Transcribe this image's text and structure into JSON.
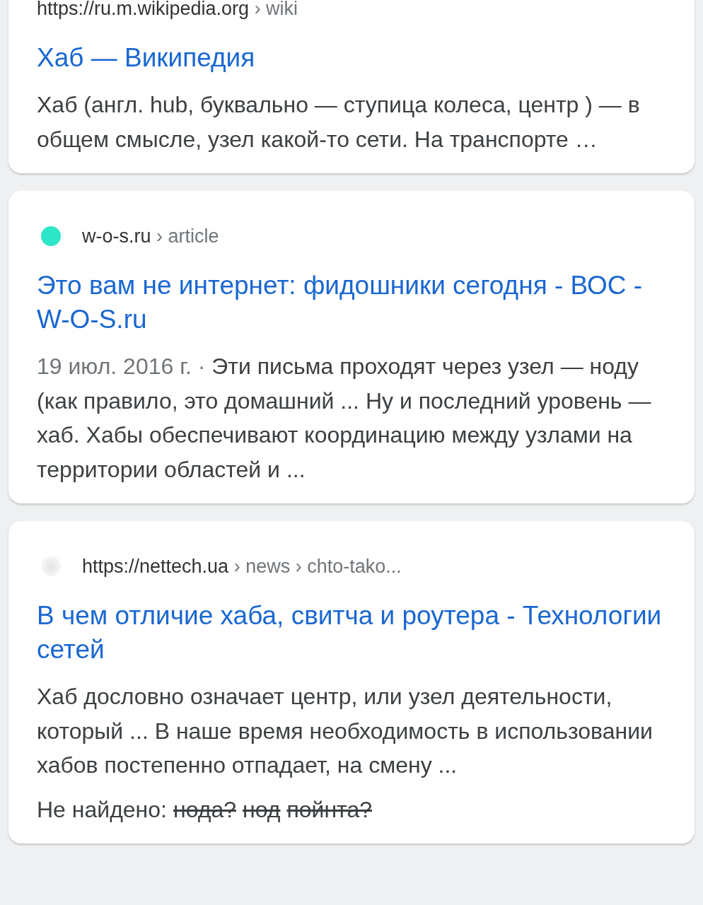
{
  "results": [
    {
      "kind": "plain",
      "site": "https://ru.m.wikipedia.org",
      "path": " › wiki",
      "title": "Хаб — Википедия",
      "snippet": "Хаб (англ. hub, буквально — ступица колеса, центр ) — в общем смысле, узел какой-то сети. На транспорте …"
    },
    {
      "kind": "dot",
      "color": "#2ee6c8",
      "site": "w-o-s.ru",
      "path": " › article",
      "title": "Это вам не интернет: фидошники сегодня - ВОС - W-O-S.ru",
      "date": "19 июл. 2016 г. · ",
      "snippet": "Эти письма проходят через узел — ноду (как правило, это домашний ... Ну и последний уровень — хаб. Хабы обеспечивают координацию между узлами на территории областей и ..."
    },
    {
      "kind": "blank",
      "site": "https://nettech.ua",
      "path": " › news › chto-tako...",
      "title": "В чем отличие хаба, свитча и роутера - Технологии сетей",
      "snippet": "Хаб дословно означает центр, или узел деятельности, который ... В наше время необходимость в использовании хабов постепенно отпадает, на смену ...",
      "missing": {
        "label": "Не найдено:",
        "terms": [
          "нода?",
          "нод",
          "пойнта?"
        ]
      }
    }
  ]
}
